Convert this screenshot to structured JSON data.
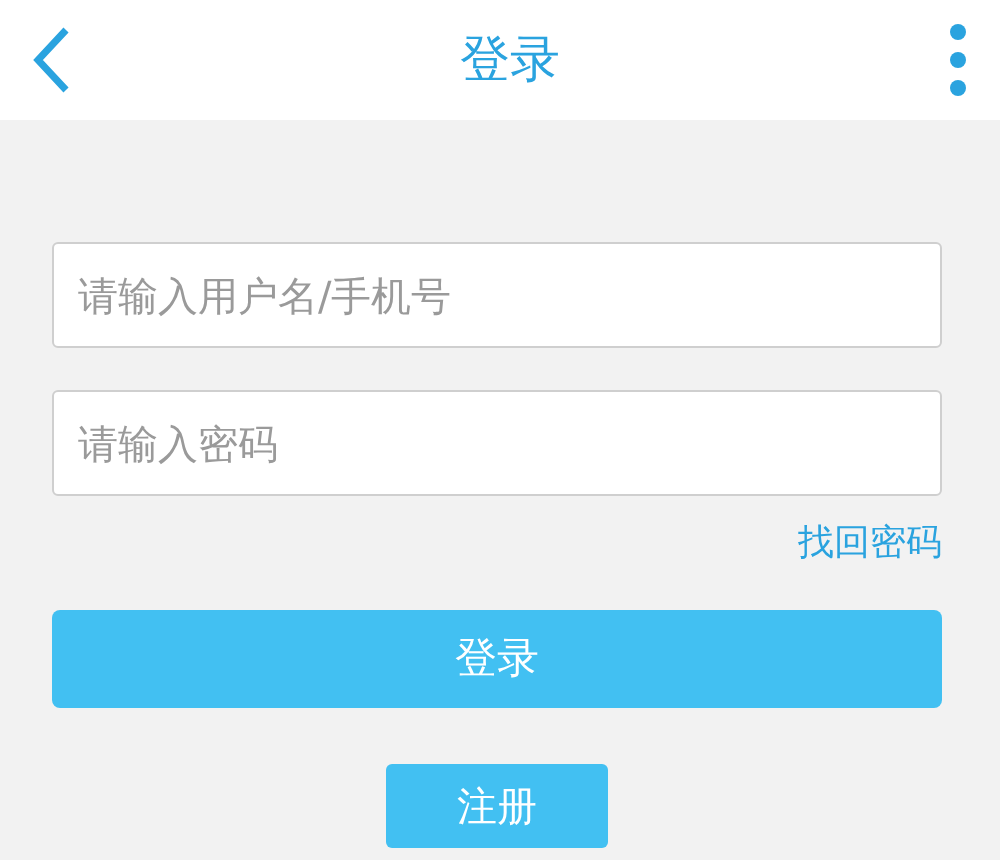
{
  "header": {
    "title": "登录"
  },
  "fields": [
    {
      "placeholder": "请输入用户名/手机号"
    },
    {
      "placeholder": "请输入密码"
    }
  ],
  "forgot_link": "找回密码",
  "buttons": [
    {
      "label": "登录",
      "kind": "wide"
    },
    {
      "label": "注册",
      "kind": "small"
    }
  ]
}
